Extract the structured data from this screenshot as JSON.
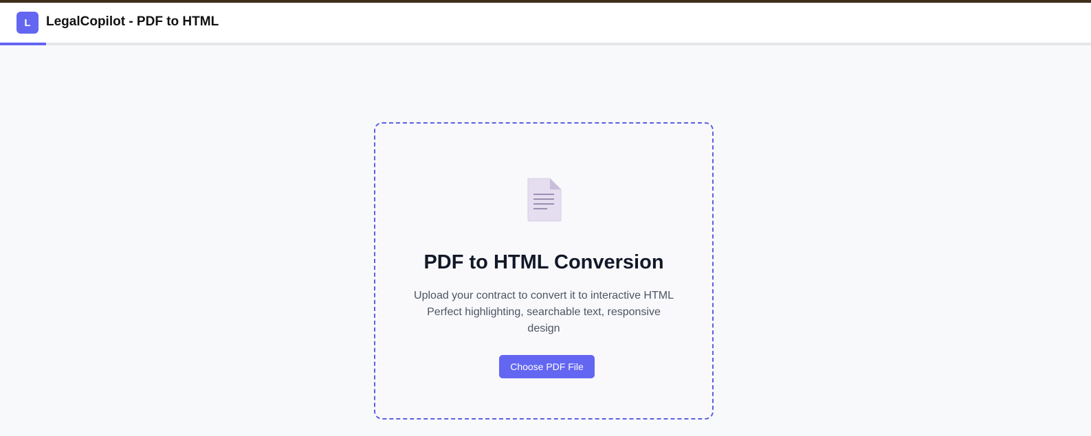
{
  "header": {
    "logo_letter": "L",
    "title": "LegalCopilot - PDF to HTML",
    "progress_fraction": 0.042
  },
  "upload": {
    "icon": "document-icon",
    "title": "PDF to HTML Conversion",
    "description_lines": [
      "Upload your contract to convert it to interactive HTML",
      "Perfect highlighting, searchable text, responsive",
      "design"
    ],
    "button_label": "Choose PDF File"
  },
  "colors": {
    "accent": "#6366f1",
    "top_strip": "#3d2e1c",
    "background": "#f8f9fb",
    "title_text": "#111827",
    "body_text": "#4b5563"
  }
}
